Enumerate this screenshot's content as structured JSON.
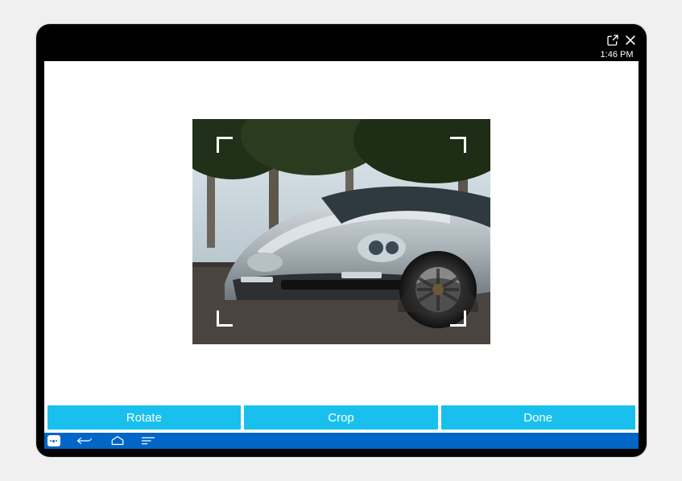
{
  "topbar": {
    "share_icon": "share-icon",
    "close_icon": "close-icon"
  },
  "status": {
    "time": "1:46 PM"
  },
  "image": {
    "alt": "silver sports sedan front three-quarter view with trees behind"
  },
  "actions": {
    "rotate": "Rotate",
    "crop": "Crop",
    "done": "Done"
  },
  "nav": {
    "teamviewer_icon": "teamviewer-icon",
    "back_icon": "back-icon",
    "home_icon": "home-icon",
    "recent_icon": "recent-apps-icon"
  }
}
